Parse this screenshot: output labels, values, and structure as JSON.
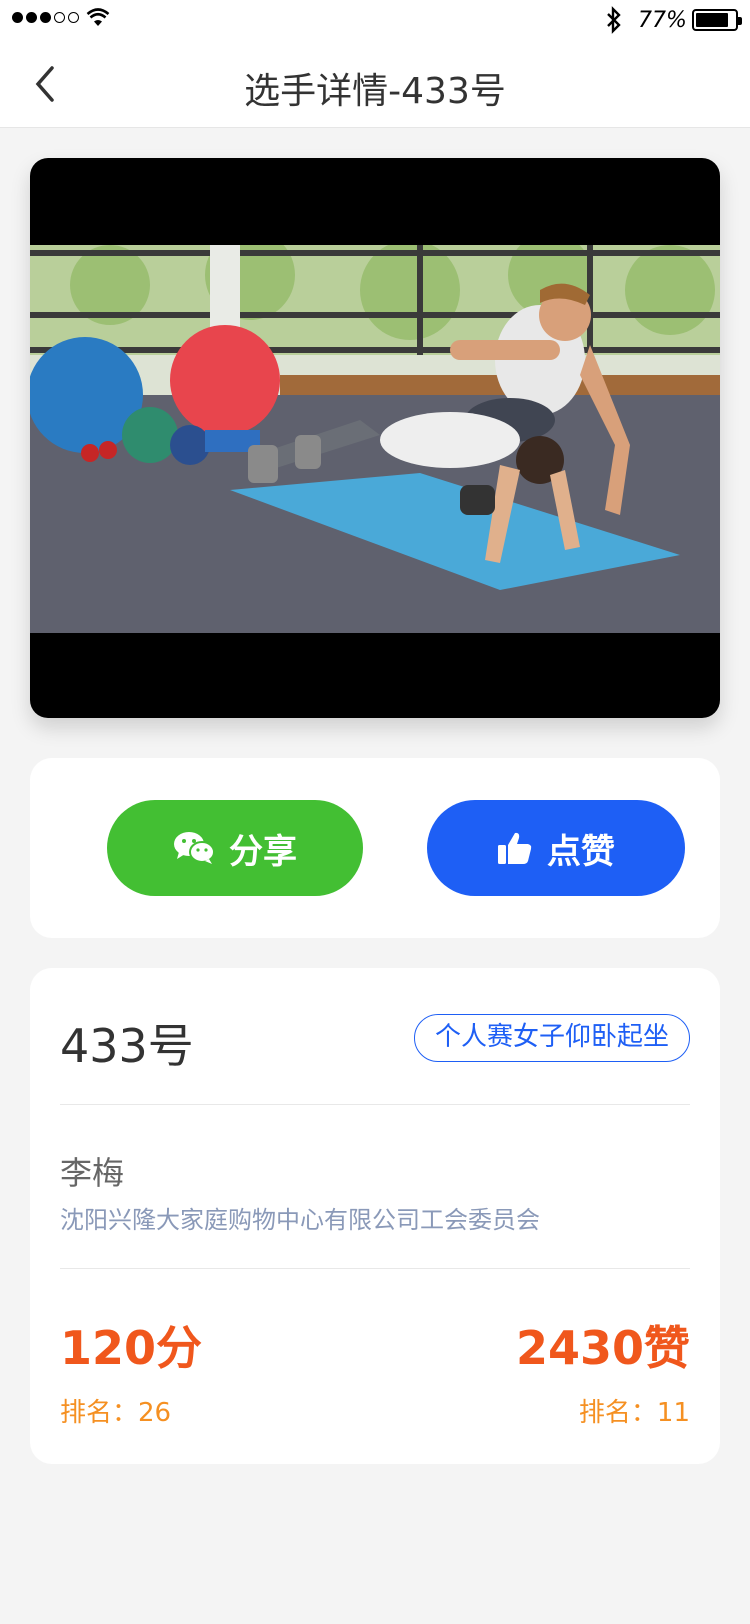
{
  "status_bar": {
    "battery_percent": "77%",
    "battery_level": 0.77,
    "signal_bars_filled": 3,
    "signal_bars_total": 5
  },
  "nav": {
    "title": "选手详情-433号"
  },
  "actions": {
    "share_label": "分享",
    "like_label": "点赞"
  },
  "player": {
    "number": "433号",
    "category": "个人赛女子仰卧起坐",
    "name": "李梅",
    "organization": "沈阳兴隆大家庭购物中心有限公司工会委员会",
    "score": "120分",
    "score_rank_label": "排名：",
    "score_rank": "26",
    "likes": "2430赞",
    "likes_rank_label": "排名：",
    "likes_rank": "11"
  },
  "colors": {
    "share_green": "#43bf33",
    "like_blue": "#1e5ff5",
    "accent_orange": "#f0571c",
    "rank_orange": "#f59022"
  }
}
